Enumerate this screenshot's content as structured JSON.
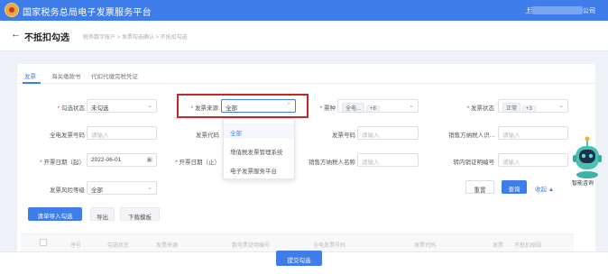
{
  "app": {
    "title": "国家税务总局电子发票服务平台",
    "user": "上海",
    "user_suffix": "公司",
    "user_icon": "person-icon"
  },
  "header": {
    "back": "←",
    "title": "不抵扣勾选",
    "breadcrumb": "税务数字账户 > 发票勾选确认 > 不抵扣勾选"
  },
  "tabs": [
    {
      "label": "发票",
      "active": true
    },
    {
      "label": "海关缴款书",
      "active": false
    },
    {
      "label": "代扣代缴完税凭证",
      "active": false
    }
  ],
  "filters": {
    "gouxuan_status": {
      "label": "勾选状态",
      "required": true,
      "value": "未勾选"
    },
    "source": {
      "label": "发票来源",
      "required": true,
      "value": "全部"
    },
    "invoice_type": {
      "label": "票种",
      "required": true,
      "tags": [
        "全电...",
        "+8"
      ]
    },
    "invoice_status": {
      "label": "发票状态",
      "required": true,
      "tags": [
        "正常",
        "+3"
      ]
    },
    "full_number": {
      "label": "全电发票号码",
      "placeholder": "请输入"
    },
    "invoice_code": {
      "label": "发票代码",
      "placeholder": ""
    },
    "invoice_number": {
      "label": "发票号码",
      "placeholder": "请输入"
    },
    "seller_taxid": {
      "label": "销售方纳税人识...",
      "placeholder": "请输入"
    },
    "date_from": {
      "label": "开票日期（起）",
      "required": true,
      "value": "2022-06-01"
    },
    "date_to": {
      "label": "开票日期（止）",
      "required": true,
      "value": ""
    },
    "seller_name": {
      "label": "销售方纳税人名称",
      "placeholder": "请输入"
    },
    "fuel_code": {
      "label": "转内销证明编号",
      "placeholder": "请输入"
    },
    "risk_level": {
      "label": "发票风险等级",
      "value": "全部"
    }
  },
  "dropdown": {
    "options": [
      {
        "label": "全部",
        "selected": true
      },
      {
        "label": "增值税发票管理系统",
        "selected": false
      },
      {
        "label": "电子发票服务平台",
        "selected": false
      }
    ]
  },
  "actions": {
    "reset": "重置",
    "query": "查询",
    "collapse": "收起 ▲"
  },
  "toolbar": {
    "import_check": "清单导入勾选",
    "export": "导出",
    "download_template": "下载模板"
  },
  "table": {
    "columns": [
      "序号",
      "勾选状态",
      "发票来源",
      "数电票证明编号",
      "全电发票号码",
      "发票代码",
      "发票",
      "不抵扣原因"
    ]
  },
  "footer": {
    "submit": "提交勾选"
  },
  "assistant": {
    "label": "智能咨询"
  },
  "colors": {
    "primary": "#3f7dea",
    "highlight": "#c62828"
  }
}
